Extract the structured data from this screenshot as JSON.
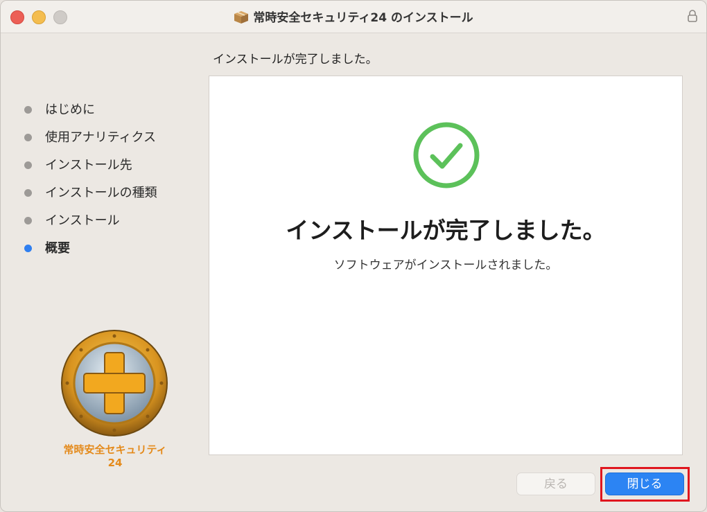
{
  "window": {
    "title": "常時安全セキュリティ24 のインストール"
  },
  "page": {
    "heading": "インストールが完了しました。"
  },
  "sidebar": {
    "steps": [
      {
        "label": "はじめに",
        "active": false
      },
      {
        "label": "使用アナリティクス",
        "active": false
      },
      {
        "label": "インストール先",
        "active": false
      },
      {
        "label": "インストールの種類",
        "active": false
      },
      {
        "label": "インストール",
        "active": false
      },
      {
        "label": "概要",
        "active": true
      }
    ],
    "logo_text": "常時安全セキュリティ24"
  },
  "content": {
    "main_message": "インストールが完了しました。",
    "sub_message": "ソフトウェアがインストールされました。"
  },
  "buttons": {
    "back_label": "戻る",
    "close_label": "閉じる"
  },
  "colors": {
    "accent": "#2c84f3",
    "success": "#5cc15a",
    "highlight": "#e0161e",
    "logo_orange": "#e48a1b"
  },
  "icons": {
    "package": "package-icon",
    "lock": "lock-icon",
    "check": "checkmark-circle-icon",
    "logo": "plus-shield-logo"
  }
}
